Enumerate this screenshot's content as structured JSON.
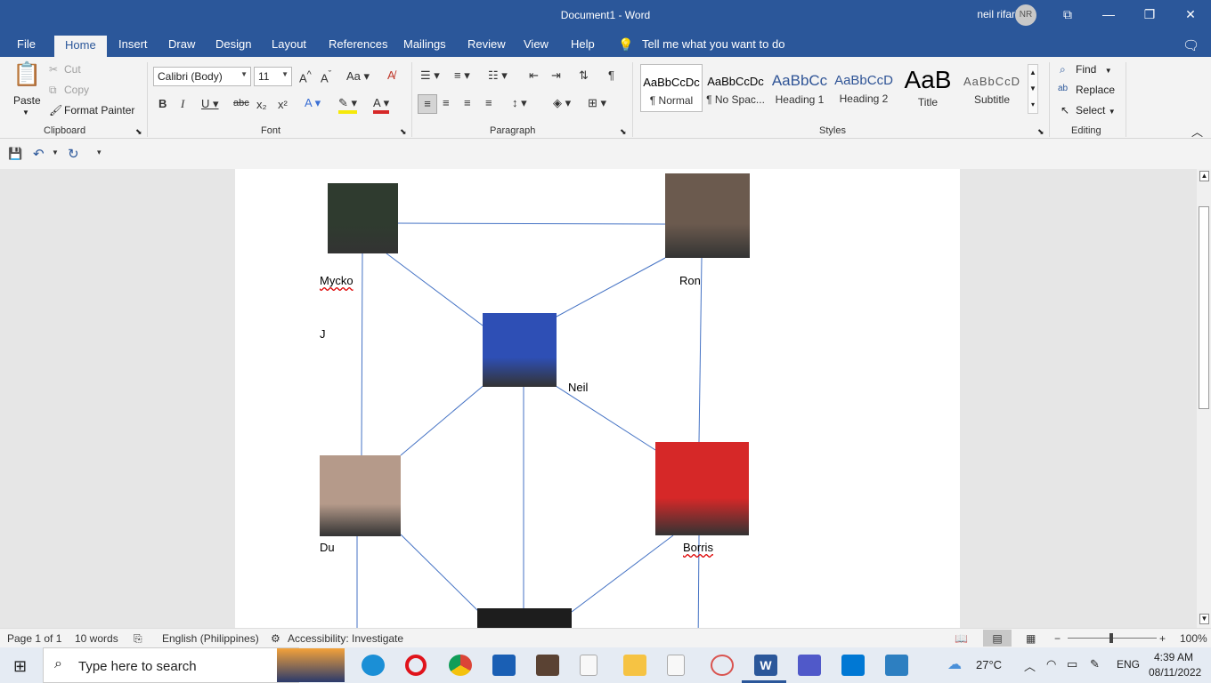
{
  "window": {
    "title": "Document1  -  Word",
    "user_name": "neil rifarial",
    "user_initials": "NR"
  },
  "tabs": [
    "File",
    "Home",
    "Insert",
    "Draw",
    "Design",
    "Layout",
    "References",
    "Mailings",
    "Review",
    "View",
    "Help"
  ],
  "tell_me": "Tell me what you want to do",
  "clipboard": {
    "paste": "Paste",
    "cut": "Cut",
    "copy": "Copy",
    "format_painter": "Format Painter",
    "group": "Clipboard"
  },
  "font": {
    "name": "Calibri (Body)",
    "size": "11",
    "group": "Font"
  },
  "paragraph": {
    "group": "Paragraph"
  },
  "styles": {
    "group": "Styles",
    "items": [
      {
        "preview": "AaBbCcDc",
        "name": "¶ Normal"
      },
      {
        "preview": "AaBbCcDc",
        "name": "¶ No Spac..."
      },
      {
        "preview": "AaBbCc",
        "name": "Heading 1"
      },
      {
        "preview": "AaBbCcD",
        "name": "Heading 2"
      },
      {
        "preview": "AaB",
        "name": "Title"
      },
      {
        "preview": "AaBbCcD",
        "name": "Subtitle"
      }
    ]
  },
  "editing": {
    "group": "Editing",
    "find": "Find",
    "replace": "Replace",
    "select": "Select"
  },
  "document": {
    "people": [
      {
        "name": "Mycko",
        "color": "#2f3b2f"
      },
      {
        "name": "Ron",
        "color": "#6b5a4e"
      },
      {
        "name": "Neil",
        "color": "#2e4fb5"
      },
      {
        "name": "Du",
        "color": "#b59a8a"
      },
      {
        "name": "Borris",
        "color": "#d62828"
      }
    ],
    "stray_char": "J",
    "bottom_photo_color": "#1d1d1d",
    "line_color": "#4472c4"
  },
  "status": {
    "page": "Page 1 of 1",
    "words": "10 words",
    "language": "English (Philippines)",
    "accessibility": "Accessibility: Investigate",
    "zoom": "100%"
  },
  "taskbar": {
    "search_placeholder": "Type here to search",
    "weather": "27°C",
    "lang": "ENG",
    "time": "4:39 AM",
    "date": "08/11/2022"
  }
}
